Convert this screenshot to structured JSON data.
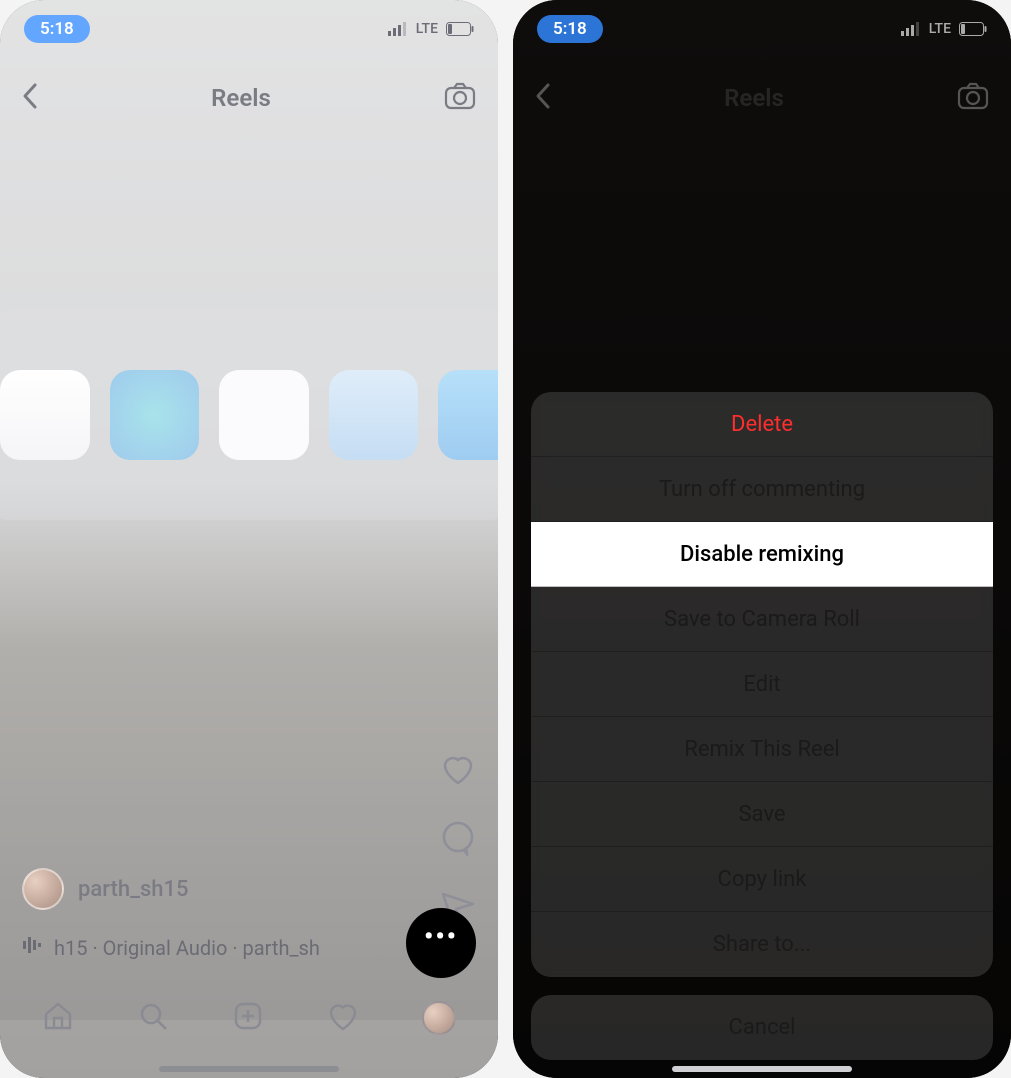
{
  "status": {
    "time": "5:18",
    "network": "LTE"
  },
  "left": {
    "nav_title": "Reels",
    "username": "parth_sh15",
    "audio_text": "h15 · Original Audio · parth_sh"
  },
  "sheet": {
    "items": [
      {
        "label": "Delete",
        "kind": "destructive"
      },
      {
        "label": "Turn off commenting",
        "kind": "normal"
      },
      {
        "label": "Disable remixing",
        "kind": "highlight"
      },
      {
        "label": "Save to Camera Roll",
        "kind": "normal"
      },
      {
        "label": "Edit",
        "kind": "normal"
      },
      {
        "label": "Remix This Reel",
        "kind": "normal"
      },
      {
        "label": "Save",
        "kind": "normal"
      },
      {
        "label": "Copy link",
        "kind": "normal"
      },
      {
        "label": "Share to...",
        "kind": "normal"
      }
    ],
    "cancel": "Cancel"
  }
}
